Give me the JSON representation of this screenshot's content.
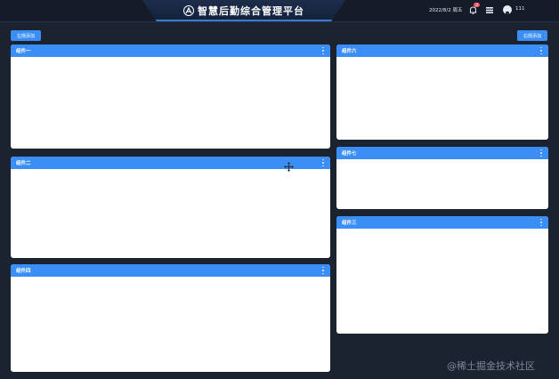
{
  "header": {
    "title": "智慧后勤综合管理平台",
    "date": "2022/8/2 周五",
    "notification_count": "3",
    "username": "111"
  },
  "toolbar": {
    "left_button": "左侧添加",
    "right_button": "右侧添加"
  },
  "panels": {
    "p1": "组件一",
    "p2": "组件二",
    "p4": "组件四",
    "p6": "组件六",
    "p7": "组件七",
    "p3": "组件三"
  },
  "icons": {
    "logo": "logo-icon",
    "notification": "bell-icon",
    "apps": "grid-icon",
    "user": "user-icon",
    "panel_menu": "more-vertical-icon",
    "drag_cursor": "move-icon"
  },
  "colors": {
    "background": "#1b2230",
    "accent": "#3a8ef6",
    "panel": "#ffffff",
    "badge": "#f5576c"
  },
  "watermark": "@稀土掘金技术社区"
}
